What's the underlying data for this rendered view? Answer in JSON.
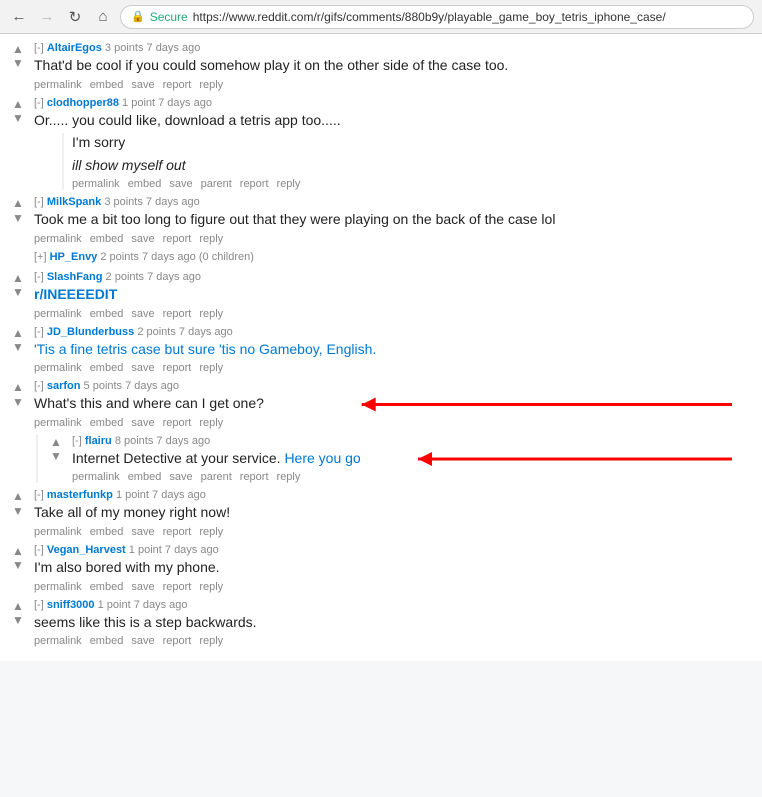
{
  "browser": {
    "url": "https://www.reddit.com/r/gifs/comments/880b9y/playable_game_boy_tetris_iphone_case/",
    "secure_label": "Secure"
  },
  "comments": [
    {
      "id": "altairegos",
      "expand": "[-]",
      "username": "AltairEgos",
      "points": "3 points",
      "time": "7 days ago",
      "text": "That'd be cool if you could somehow play it on the other side of the case too.",
      "italic": false,
      "actions": [
        "permalink",
        "embed",
        "save",
        "report",
        "reply"
      ],
      "nested": []
    },
    {
      "id": "clodhopper88",
      "expand": "[-]",
      "username": "clodhopper88",
      "points": "1 point",
      "time": "7 days ago",
      "text": "Or..... you could like, download a tetris app too.....",
      "italic": false,
      "actions": [],
      "nested": [
        {
          "id": "clodhopper88-sub1",
          "text": "I'm sorry",
          "italic": false
        },
        {
          "id": "clodhopper88-sub2",
          "text": "ill show myself out",
          "italic": true,
          "actions": [
            "permalink",
            "embed",
            "save",
            "parent",
            "report",
            "reply"
          ]
        }
      ]
    },
    {
      "id": "milkspank",
      "expand": "[-]",
      "username": "MilkSpank",
      "points": "3 points",
      "time": "7 days ago",
      "text": "Took me a bit too long to figure out that they were playing on the back of the case lol",
      "italic": false,
      "actions": [
        "permalink",
        "embed",
        "save",
        "report",
        "reply"
      ],
      "nested": []
    },
    {
      "id": "hp_envy",
      "expand": "[+]",
      "username": "HP_Envy",
      "points": "2 points",
      "time": "7 days ago",
      "extra": "(0 children)",
      "collapsed": true,
      "text": "",
      "italic": false,
      "actions": [],
      "nested": []
    },
    {
      "id": "slashfang",
      "expand": "[-]",
      "username": "SlashFang",
      "points": "2 points",
      "time": "7 days ago",
      "text": "r/INEEEEDIT",
      "is_rlink": true,
      "italic": false,
      "actions": [
        "permalink",
        "embed",
        "save",
        "report",
        "reply"
      ],
      "nested": []
    },
    {
      "id": "jd_blunderbuss",
      "expand": "[-]",
      "username": "JD_Blunderbuss",
      "points": "2 points",
      "time": "7 days ago",
      "text": "'Tis a fine tetris case but sure 'tis no Gameboy, English.",
      "is_link": true,
      "italic": false,
      "actions": [
        "permalink",
        "embed",
        "save",
        "report",
        "reply"
      ],
      "nested": []
    },
    {
      "id": "sarfon",
      "expand": "[-]",
      "username": "sarfon",
      "points": "5 points",
      "time": "7 days ago",
      "text": "What's this and where can I get one?",
      "italic": false,
      "actions": [
        "permalink",
        "embed",
        "save",
        "report",
        "reply"
      ],
      "arrow1": true,
      "nested": []
    },
    {
      "id": "flairu",
      "expand": "[-]",
      "username": "flairu",
      "points": "8 points",
      "time": "7 days ago",
      "text_prefix": "Internet Detective at your service. ",
      "text_link": "Here you go",
      "italic": false,
      "actions": [
        "permalink",
        "embed",
        "save",
        "parent",
        "report",
        "reply"
      ],
      "arrow2": true,
      "nested": []
    },
    {
      "id": "masterfunkp",
      "expand": "[-]",
      "username": "masterfunkp",
      "points": "1 point",
      "time": "7 days ago",
      "text": "Take all of my money right now!",
      "italic": false,
      "actions": [
        "permalink",
        "embed",
        "save",
        "report",
        "reply"
      ],
      "nested": []
    },
    {
      "id": "vegan_harvest",
      "expand": "[-]",
      "username": "Vegan_Harvest",
      "points": "1 point",
      "time": "7 days ago",
      "text": "I'm also bored with my phone.",
      "italic": false,
      "actions": [
        "permalink",
        "embed",
        "save",
        "report",
        "reply"
      ],
      "nested": []
    },
    {
      "id": "sniff3000",
      "expand": "[-]",
      "username": "sniff3000",
      "points": "1 point",
      "time": "7 days ago",
      "text": "seems like this is a step backwards.",
      "italic": false,
      "actions": [
        "permalink",
        "embed",
        "save",
        "report",
        "reply"
      ],
      "nested": []
    }
  ]
}
